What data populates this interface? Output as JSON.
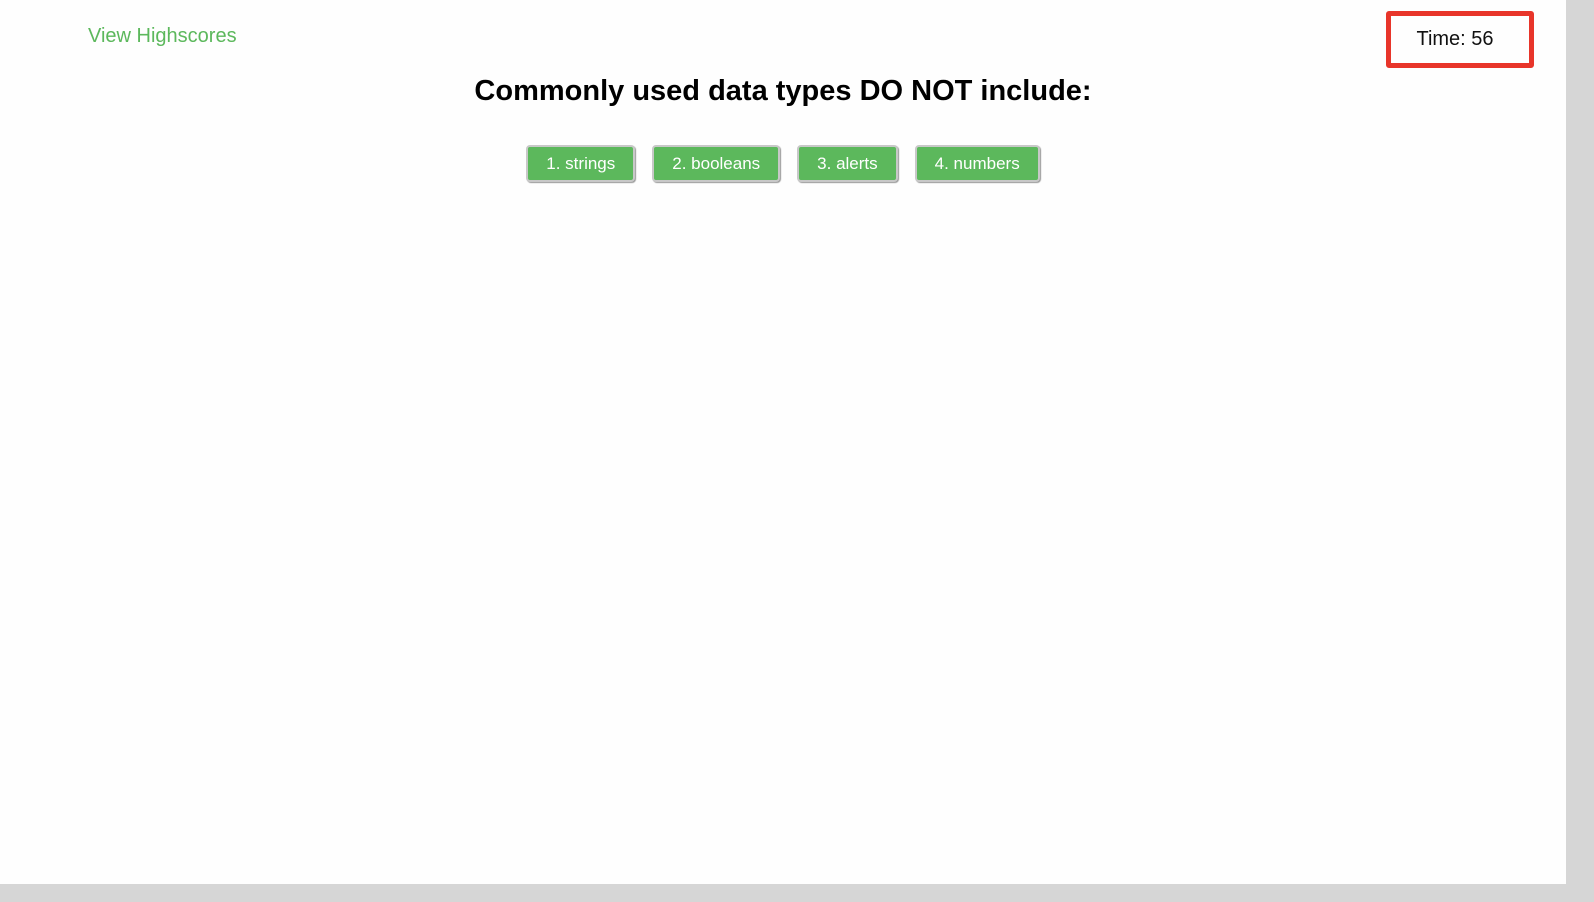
{
  "header": {
    "highscores_link": "View Highscores",
    "timer": "Time: 56"
  },
  "question": {
    "title": "Commonly used data types DO NOT include:",
    "choices": [
      "1. strings",
      "2. booleans",
      "3. alerts",
      "4. numbers"
    ]
  },
  "colors": {
    "accent": "#5cb85c",
    "timer_border": "#e8352a"
  }
}
